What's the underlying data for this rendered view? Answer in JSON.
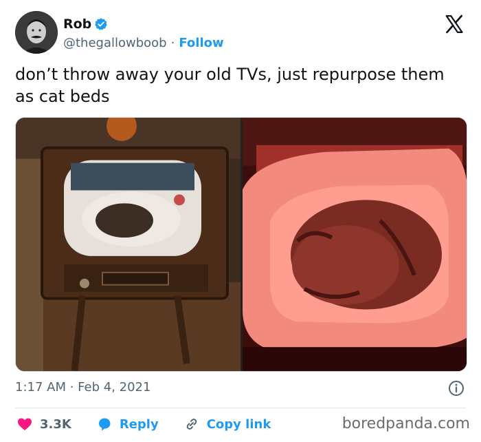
{
  "author": {
    "name": "Rob",
    "handle": "@thegallowboob",
    "separator": "·",
    "follow_label": "Follow",
    "verified_color": "#1d9bf0"
  },
  "tweet": {
    "text": "don’t throw away your old TVs, just repurpose them as cat beds",
    "timestamp": "1:17 AM · Feb 4, 2021"
  },
  "media": [
    {
      "icon": "photo-vintage-tv-cat-bed"
    },
    {
      "icon": "photo-cat-sleeping-red-light"
    }
  ],
  "actions": {
    "likes": "3.3K",
    "reply_label": "Reply",
    "copy_link_label": "Copy link"
  },
  "watermark": "boredpanda.com",
  "colors": {
    "accent": "#1d9bf0",
    "like": "#f91880",
    "text": "#0f1419",
    "muted": "#536471"
  }
}
